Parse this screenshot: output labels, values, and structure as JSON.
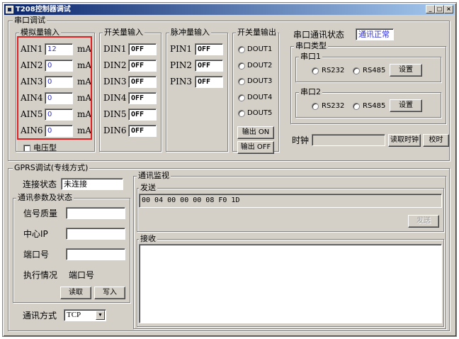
{
  "window": {
    "title": "T208控制器调试"
  },
  "serial_debug": {
    "title": "串口调试",
    "analog": {
      "title": "模拟量输入",
      "unit": "mA",
      "rows": [
        {
          "label": "AIN1",
          "value": "12"
        },
        {
          "label": "AIN2",
          "value": "0"
        },
        {
          "label": "AIN3",
          "value": "0"
        },
        {
          "label": "AIN4",
          "value": "0"
        },
        {
          "label": "AIN5",
          "value": "0"
        },
        {
          "label": "AIN6",
          "value": "0"
        }
      ],
      "voltage_label": "电压型"
    },
    "digital_in": {
      "title": "开关量输入",
      "rows": [
        {
          "label": "DIN1",
          "value": "OFF"
        },
        {
          "label": "DIN2",
          "value": "OFF"
        },
        {
          "label": "DIN3",
          "value": "OFF"
        },
        {
          "label": "DIN4",
          "value": "OFF"
        },
        {
          "label": "DIN5",
          "value": "OFF"
        },
        {
          "label": "DIN6",
          "value": "OFF"
        }
      ]
    },
    "pulse_in": {
      "title": "脉冲量输入",
      "rows": [
        {
          "label": "PIN1",
          "value": "OFF"
        },
        {
          "label": "PIN2",
          "value": "OFF"
        },
        {
          "label": "PIN3",
          "value": "OFF"
        }
      ]
    },
    "digital_out": {
      "title": "开关量输出",
      "items": [
        "DOUT1",
        "DOUT2",
        "DOUT3",
        "DOUT4",
        "DOUT5"
      ],
      "on_label": "输出 ON",
      "off_label": "输出 OFF"
    },
    "comm_status": {
      "label": "串口通讯状态",
      "value": "通讯正常"
    },
    "port_type": {
      "title": "串口类型",
      "port1": {
        "title": "串口1",
        "rs232": "RS232",
        "rs485": "RS485",
        "set": "设置"
      },
      "port2": {
        "title": "串口2",
        "rs232": "RS232",
        "rs485": "RS485",
        "set": "设置"
      }
    },
    "clock": {
      "label": "时钟",
      "value": "",
      "read": "读取时钟",
      "calibrate": "校时"
    }
  },
  "gprs": {
    "title": "GPRS调试(专线方式)",
    "connection": {
      "label": "连接状态",
      "value": "未连接"
    },
    "params": {
      "title": "通讯参数及状态",
      "signal": {
        "label": "信号质量",
        "value": ""
      },
      "center_ip": {
        "label": "中心IP",
        "value": ""
      },
      "port": {
        "label": "端口号",
        "value": ""
      },
      "exec": {
        "label": "执行情况",
        "value": "端口号"
      },
      "read": "读取",
      "write": "写入"
    },
    "mode": {
      "label": "通讯方式",
      "value": "TCP"
    },
    "monitor": {
      "title": "通讯监视",
      "send": {
        "title": "发送",
        "content": "00 04 00 00 00 08 F0 1D",
        "button": "发送"
      },
      "receive": {
        "title": "接收",
        "content": ""
      }
    }
  }
}
